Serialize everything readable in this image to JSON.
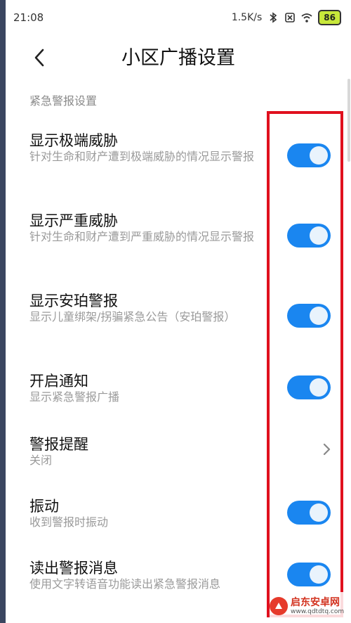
{
  "status_bar": {
    "time": "21:08",
    "network_speed": "1.5K/s",
    "battery": "86",
    "icons": [
      "bluetooth-icon",
      "no-sim-icon",
      "wifi-icon",
      "battery-icon"
    ]
  },
  "header": {
    "title": "小区广播设置"
  },
  "section": {
    "label": "紧急警报设置"
  },
  "settings": [
    {
      "title": "显示极端威胁",
      "subtitle": "针对生命和财产遭到极端威胁的情况显示警报",
      "control": "toggle",
      "on": true
    },
    {
      "title": "显示严重威胁",
      "subtitle": "针对生命和财产遭到严重威胁的情况显示警报",
      "control": "toggle",
      "on": true
    },
    {
      "title": "显示安珀警报",
      "subtitle": "显示儿童绑架/拐骗紧急公告（安珀警报）",
      "control": "toggle",
      "on": true
    },
    {
      "title": "开启通知",
      "subtitle": "显示紧急警报广播",
      "control": "toggle",
      "on": true
    },
    {
      "title": "警报提醒",
      "subtitle": "关闭",
      "control": "chevron"
    },
    {
      "title": "振动",
      "subtitle": "收到警报时振动",
      "control": "toggle",
      "on": true
    },
    {
      "title": "读出警报消息",
      "subtitle": "使用文字转语音功能读出紧急警报消息",
      "control": "toggle",
      "on": true
    }
  ],
  "watermark": {
    "name": "启东安卓网",
    "url": "www.qdtdtq.com"
  },
  "colors": {
    "toggle_on": "#1a86f0",
    "highlight_box": "#e0101e",
    "battery": "#c7e73a"
  }
}
